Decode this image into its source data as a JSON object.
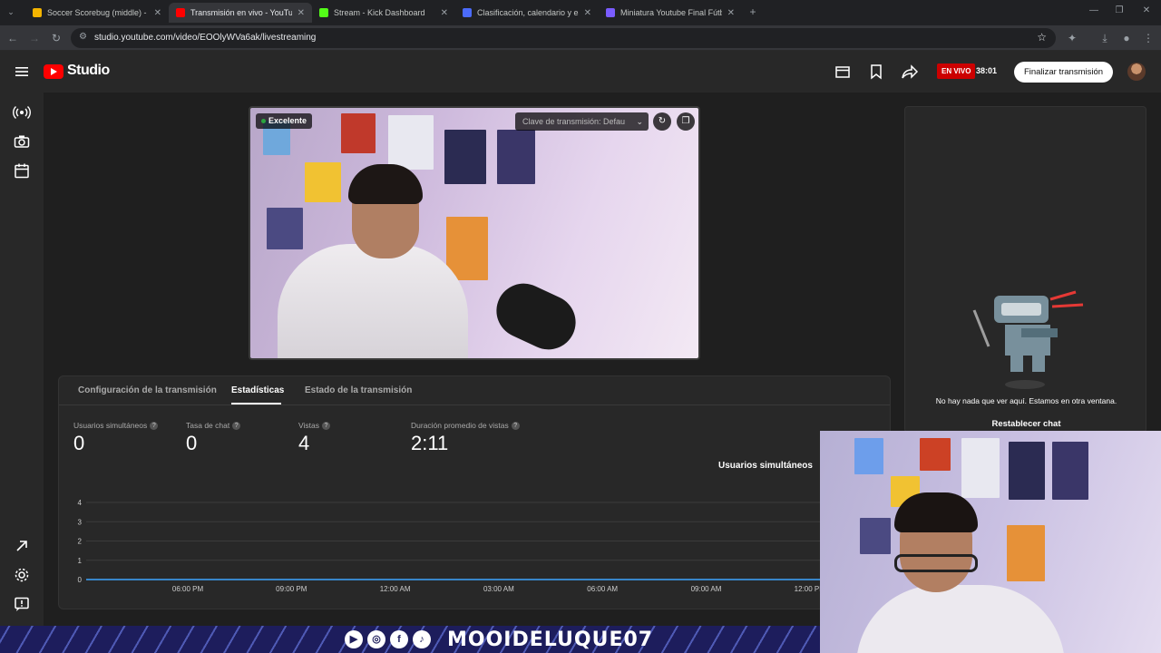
{
  "browser": {
    "tabs": [
      {
        "title": "Soccer Scorebug (middle) - Sta",
        "fav_color": "#f4b400",
        "active": false
      },
      {
        "title": "Transmisión en vivo - YouTube",
        "fav_color": "#ff0000",
        "active": true
      },
      {
        "title": "Stream - Kick Dashboard",
        "fav_color": "#53fc18",
        "active": false
      },
      {
        "title": "Clasificación, calendario y estad",
        "fav_color": "#4b6bfb",
        "active": false
      },
      {
        "title": "Miniatura Youtube Final Fútbol",
        "fav_color": "#7a5cff",
        "active": false
      }
    ],
    "new_tab": "+",
    "close_glyph": "✕",
    "url": "studio.youtube.com/video/EOOlyWVa6ak/livestreaming"
  },
  "header": {
    "logo_text": "Studio",
    "live_badge": "EN VIVO",
    "live_time": "38:01",
    "end_button": "Finalizar transmisión"
  },
  "preview": {
    "quality": "Excelente",
    "stream_key": "Clave de transmisión: Defau",
    "refresh_glyph": "↻",
    "copy_glyph": "❐"
  },
  "tabs": [
    {
      "label": "Configuración de la transmisión"
    },
    {
      "label": "Estadísticas"
    },
    {
      "label": "Estado de la transmisión"
    }
  ],
  "metrics": [
    {
      "label": "Usuarios simultáneos",
      "value": "0"
    },
    {
      "label": "Tasa de chat",
      "value": "0"
    },
    {
      "label": "Vistas",
      "value": "4"
    },
    {
      "label": "Duración promedio de vistas",
      "value": "2:11"
    }
  ],
  "metric_help_glyph": "?",
  "chart_series_label": "Usuarios simultáneos",
  "chart_data": {
    "type": "line",
    "series": [
      {
        "name": "Usuarios simultáneos",
        "values": [
          0,
          0,
          0,
          0,
          0,
          0,
          0,
          0
        ]
      }
    ],
    "x": [
      "06:00 PM",
      "09:00 PM",
      "12:00 AM",
      "03:00 AM",
      "06:00 AM",
      "09:00 AM",
      "12:00 PM"
    ],
    "y_ticks": [
      "0",
      "1",
      "2",
      "3",
      "4"
    ],
    "ylim": [
      0,
      4
    ],
    "grid": true,
    "line_color": "#3ea6ff"
  },
  "chat": {
    "empty_message": "No hay nada que ver aquí. Estamos en otra ventana.",
    "reset_label": "Restablecer chat"
  },
  "banner": {
    "text": "MOOIDELUQUE07",
    "socials": [
      "▶",
      "◎",
      "f",
      "♪"
    ]
  }
}
